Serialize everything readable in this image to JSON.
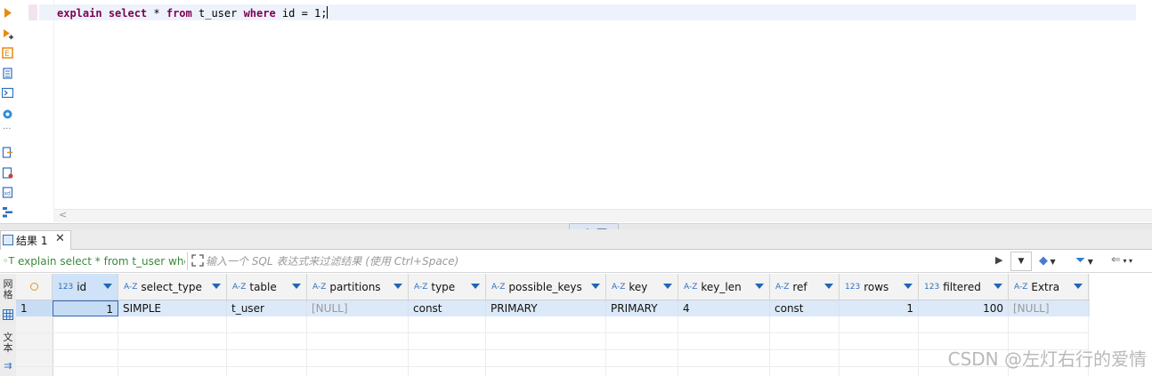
{
  "editor": {
    "sql_tokens": [
      {
        "t": "explain",
        "k": "kw"
      },
      {
        "t": " ",
        "k": "pl"
      },
      {
        "t": "select",
        "k": "kw"
      },
      {
        "t": " * ",
        "k": "pl"
      },
      {
        "t": "from",
        "k": "kw"
      },
      {
        "t": " t_user ",
        "k": "pl"
      },
      {
        "t": "where",
        "k": "kw"
      },
      {
        "t": " id = 1;",
        "k": "pl"
      }
    ]
  },
  "toolbar_icons": [
    "execute-statement-icon",
    "execute-script-icon",
    "explain-plan-icon",
    "history-icon",
    "console-icon",
    "settings-icon",
    "more-icon",
    "export-icon",
    "new-script-icon",
    "format-icon",
    "outline-icon"
  ],
  "result_tab": {
    "label": "结果 1",
    "close": "✕"
  },
  "filter": {
    "query_text": "explain select * from t_user wher",
    "placeholder": "输入一个 SQL 表达式来过滤结果 (使用 Ctrl+Space)"
  },
  "side_tabs": [
    "网格",
    "文本"
  ],
  "columns": [
    {
      "type": "123",
      "name": "id"
    },
    {
      "type": "A-Z",
      "name": "select_type"
    },
    {
      "type": "A-Z",
      "name": "table"
    },
    {
      "type": "A-Z",
      "name": "partitions"
    },
    {
      "type": "A-Z",
      "name": "type"
    },
    {
      "type": "A-Z",
      "name": "possible_keys"
    },
    {
      "type": "A-Z",
      "name": "key"
    },
    {
      "type": "A-Z",
      "name": "key_len"
    },
    {
      "type": "A-Z",
      "name": "ref"
    },
    {
      "type": "123",
      "name": "rows"
    },
    {
      "type": "123",
      "name": "filtered"
    },
    {
      "type": "A-Z",
      "name": "Extra"
    }
  ],
  "rows": [
    {
      "num": "1",
      "cells": [
        "1",
        "SIMPLE",
        "t_user",
        "[NULL]",
        "const",
        "PRIMARY",
        "PRIMARY",
        "4",
        "const",
        "1",
        "100",
        "[NULL]"
      ]
    }
  ],
  "watermark": "CSDN @左灯右行的爱情",
  "colors": {
    "keyword": "#7f0055",
    "selection": "#dce9f8",
    "accent": "#1f66b6",
    "query_green": "#3b8a3b"
  }
}
